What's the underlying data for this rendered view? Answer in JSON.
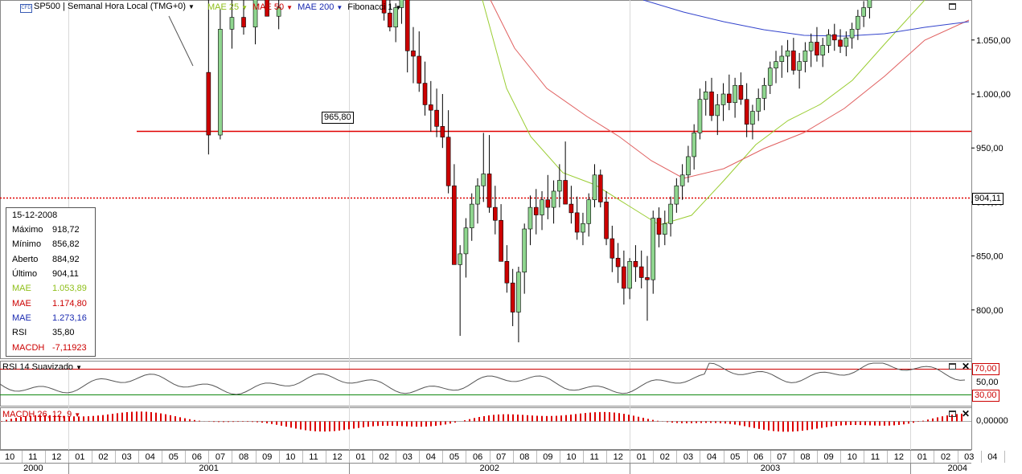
{
  "header": {
    "symbol_label": "SP500 | Semanal Hora Local (TMG+0)",
    "cfd_badge": "CFD",
    "ma1_label": "MAE 25",
    "ma2_label": "MAE 50",
    "ma3_label": "MAE 200",
    "fib_label": "Fibonacci 1",
    "colors": {
      "ma1": "#9acd32",
      "ma2": "#e02020",
      "ma3": "#2233bb",
      "fib": "#000000"
    }
  },
  "info_box": {
    "date": "15-12-2008",
    "rows": [
      {
        "k": "Máximo",
        "v": "918,72",
        "color": "#000000"
      },
      {
        "k": "Mínimo",
        "v": "856,82",
        "color": "#000000"
      },
      {
        "k": "Aberto",
        "v": "884,92",
        "color": "#000000"
      },
      {
        "k": "Último",
        "v": "904,11",
        "color": "#000000"
      },
      {
        "k": "MAE",
        "v": "1.053,89",
        "color": "#8fbf1a"
      },
      {
        "k": "MAE",
        "v": "1.174,80",
        "color": "#cc0000"
      },
      {
        "k": "MAE",
        "v": "1.273,16",
        "color": "#1a2ab0"
      },
      {
        "k": "RSI",
        "v": "35,80",
        "color": "#000000"
      },
      {
        "k": "MACDH",
        "v": "-7,11923",
        "color": "#cc0000"
      }
    ]
  },
  "annotations": {
    "level_label": "965,80",
    "last_price_label": "904,11"
  },
  "rsi_panel": {
    "title": "RSI 14 Suavizado",
    "upper": "70,00",
    "mid": "50,00",
    "lower": "30,00"
  },
  "macd_panel": {
    "title": "MACDH 26, 12, 9",
    "zero": "0,00000"
  },
  "chart_data": {
    "type": "candlestick",
    "y_ticks": [
      "1.050,00",
      "1.000,00",
      "950,00",
      "900,00",
      "850,00",
      "800,00"
    ],
    "y_tick_values": [
      1050,
      1000,
      950,
      900,
      850,
      800
    ],
    "ylim": [
      765,
      1092
    ],
    "months": [
      "10",
      "11",
      "12",
      "01",
      "02",
      "03",
      "04",
      "05",
      "06",
      "07",
      "08",
      "09",
      "10",
      "11",
      "12",
      "01",
      "02",
      "03",
      "04",
      "05",
      "06",
      "07",
      "08",
      "09",
      "10",
      "11",
      "12",
      "01",
      "02",
      "03",
      "04",
      "05",
      "06",
      "07",
      "08",
      "09",
      "10",
      "11",
      "12",
      "01",
      "02",
      "03",
      "04"
    ],
    "years": [
      {
        "label": "2000",
        "start_month_index": 0,
        "span": 3
      },
      {
        "label": "2001",
        "start_month_index": 3,
        "span": 12
      },
      {
        "label": "2002",
        "start_month_index": 15,
        "span": 12
      },
      {
        "label": "2003",
        "start_month_index": 27,
        "span": 12
      },
      {
        "label": "2004",
        "start_month_index": 39,
        "span": 4
      }
    ],
    "horizontal_levels": [
      {
        "value": 965.8,
        "style": "solid",
        "color": "#e00000"
      },
      {
        "value": 904.11,
        "style": "dotted",
        "color": "#e00000"
      }
    ],
    "candles": [
      [
        8.5,
        1020,
        1094,
        944,
        962
      ],
      [
        9.0,
        962,
        1079,
        958,
        1060
      ],
      [
        9.5,
        1060,
        1096,
        1042,
        1071
      ],
      [
        10.0,
        1071,
        1101,
        1055,
        1062
      ],
      [
        10.5,
        1062,
        1098,
        1046,
        1088
      ],
      [
        11.0,
        1088,
        1110,
        1075,
        1072
      ],
      [
        11.5,
        1072,
        1094,
        1060,
        1080
      ],
      [
        16.0,
        1098,
        1108,
        1068,
        1075
      ],
      [
        16.25,
        1075,
        1090,
        1058,
        1062
      ],
      [
        16.5,
        1062,
        1084,
        1048,
        1080
      ],
      [
        16.75,
        1080,
        1105,
        1065,
        1095
      ],
      [
        17.0,
        1095,
        1112,
        1020,
        1040
      ],
      [
        17.25,
        1040,
        1062,
        1010,
        1035
      ],
      [
        17.5,
        1035,
        1058,
        1002,
        1010
      ],
      [
        17.75,
        1010,
        1030,
        980,
        990
      ],
      [
        18.0,
        990,
        1012,
        965,
        985
      ],
      [
        18.25,
        985,
        1005,
        960,
        970
      ],
      [
        18.5,
        970,
        1000,
        950,
        960
      ],
      [
        18.75,
        960,
        985,
        908,
        915
      ],
      [
        19.0,
        915,
        935,
        846,
        842
      ],
      [
        19.25,
        842,
        860,
        776,
        852
      ],
      [
        19.5,
        852,
        885,
        830,
        876
      ],
      [
        19.75,
        876,
        908,
        864,
        898
      ],
      [
        20.0,
        898,
        922,
        880,
        915
      ],
      [
        20.25,
        915,
        964,
        900,
        926
      ],
      [
        20.5,
        926,
        962,
        890,
        895
      ],
      [
        20.75,
        895,
        915,
        870,
        883
      ],
      [
        21.0,
        883,
        898,
        850,
        845
      ],
      [
        21.25,
        845,
        860,
        816,
        825
      ],
      [
        21.5,
        825,
        838,
        785,
        798
      ],
      [
        21.75,
        798,
        840,
        770,
        835
      ],
      [
        22.0,
        835,
        880,
        815,
        875
      ],
      [
        22.25,
        875,
        906,
        860,
        895
      ],
      [
        22.5,
        895,
        912,
        870,
        888
      ],
      [
        22.75,
        888,
        910,
        874,
        902
      ],
      [
        23.0,
        902,
        925,
        884,
        895
      ],
      [
        23.25,
        895,
        920,
        880,
        910
      ],
      [
        23.5,
        910,
        935,
        895,
        920
      ],
      [
        23.75,
        920,
        956,
        900,
        898
      ],
      [
        24.0,
        898,
        915,
        880,
        890
      ],
      [
        24.25,
        890,
        905,
        865,
        872
      ],
      [
        24.5,
        872,
        890,
        860,
        880
      ],
      [
        24.75,
        880,
        908,
        868,
        902
      ],
      [
        25.0,
        902,
        935,
        895,
        925
      ],
      [
        25.25,
        925,
        930,
        895,
        900
      ],
      [
        25.5,
        900,
        910,
        860,
        866
      ],
      [
        25.75,
        866,
        878,
        835,
        848
      ],
      [
        26.0,
        848,
        862,
        825,
        840
      ],
      [
        26.25,
        840,
        855,
        805,
        820
      ],
      [
        26.5,
        820,
        848,
        810,
        845
      ],
      [
        26.75,
        845,
        860,
        826,
        840
      ],
      [
        27.0,
        840,
        855,
        820,
        830
      ],
      [
        27.25,
        830,
        850,
        790,
        828
      ],
      [
        27.5,
        828,
        892,
        815,
        885
      ],
      [
        27.75,
        885,
        895,
        858,
        870
      ],
      [
        28.0,
        870,
        892,
        860,
        880
      ],
      [
        28.25,
        880,
        905,
        868,
        898
      ],
      [
        28.5,
        898,
        922,
        890,
        915
      ],
      [
        28.75,
        915,
        935,
        902,
        925
      ],
      [
        29.0,
        925,
        952,
        918,
        942
      ],
      [
        29.25,
        942,
        972,
        930,
        964
      ],
      [
        29.5,
        964,
        1005,
        958,
        995
      ],
      [
        29.75,
        995,
        1012,
        980,
        1002
      ],
      [
        30.0,
        1002,
        1015,
        975,
        980
      ],
      [
        30.25,
        980,
        1000,
        962,
        990
      ],
      [
        30.5,
        990,
        1010,
        975,
        1000
      ],
      [
        30.75,
        1000,
        1018,
        985,
        992
      ],
      [
        31.0,
        992,
        1015,
        978,
        1008
      ],
      [
        31.25,
        1008,
        1020,
        990,
        995
      ],
      [
        31.5,
        995,
        1010,
        960,
        972
      ],
      [
        31.75,
        972,
        990,
        958,
        984
      ],
      [
        32.0,
        984,
        1005,
        975,
        996
      ],
      [
        32.25,
        996,
        1015,
        985,
        1008
      ],
      [
        32.5,
        1008,
        1030,
        1000,
        1024
      ],
      [
        32.75,
        1024,
        1040,
        1010,
        1030
      ],
      [
        33.0,
        1030,
        1045,
        1015,
        1035
      ],
      [
        33.25,
        1035,
        1050,
        1020,
        1040
      ],
      [
        33.5,
        1040,
        1052,
        1018,
        1022
      ],
      [
        33.75,
        1022,
        1038,
        1005,
        1030
      ],
      [
        34.0,
        1030,
        1048,
        1020,
        1040
      ],
      [
        34.25,
        1040,
        1056,
        1025,
        1048
      ],
      [
        34.5,
        1048,
        1062,
        1030,
        1036
      ],
      [
        34.75,
        1036,
        1052,
        1025,
        1045
      ],
      [
        35.0,
        1045,
        1060,
        1038,
        1055
      ],
      [
        35.25,
        1055,
        1065,
        1040,
        1050
      ],
      [
        35.5,
        1050,
        1060,
        1038,
        1044
      ],
      [
        35.75,
        1044,
        1058,
        1035,
        1052
      ],
      [
        36.0,
        1052,
        1066,
        1042,
        1060
      ],
      [
        36.25,
        1060,
        1078,
        1050,
        1072
      ],
      [
        36.5,
        1072,
        1086,
        1062,
        1080
      ],
      [
        36.75,
        1080,
        1098,
        1070,
        1090
      ]
    ]
  }
}
